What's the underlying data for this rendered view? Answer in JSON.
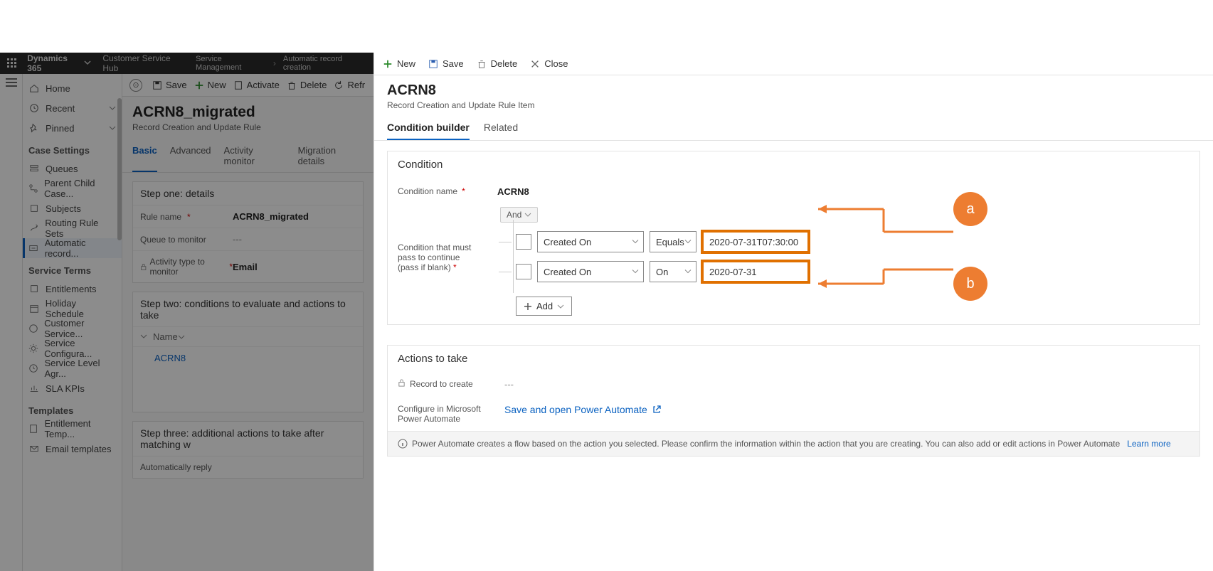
{
  "colors": {
    "accent": "#0b62c1",
    "callout": "#ed7d31"
  },
  "topbar": {
    "brand": "Dynamics 365",
    "hub": "Customer Service Hub",
    "bc1": "Service Management",
    "bc2": "Automatic record creation"
  },
  "nav": {
    "home": "Home",
    "recent": "Recent",
    "pinned": "Pinned",
    "grp_case": "Case Settings",
    "queues": "Queues",
    "parent": "Parent Child Case...",
    "subjects": "Subjects",
    "routing": "Routing Rule Sets",
    "auto": "Automatic record...",
    "grp_terms": "Service Terms",
    "entitle": "Entitlements",
    "holiday": "Holiday Schedule",
    "cust": "Customer Service...",
    "svcconf": "Service Configura...",
    "sla": "Service Level Agr...",
    "slakpi": "SLA KPIs",
    "grp_tpl": "Templates",
    "enttpl": "Entitlement Temp...",
    "emailtpl": "Email templates"
  },
  "cmdbar": {
    "save": "Save",
    "new": "New",
    "activate": "Activate",
    "delete": "Delete",
    "refresh": "Refr"
  },
  "page": {
    "title": "ACRN8_migrated",
    "subtitle": "Record Creation and Update Rule",
    "tabs": {
      "basic": "Basic",
      "advanced": "Advanced",
      "activity": "Activity monitor",
      "migration": "Migration details"
    }
  },
  "step1": {
    "title": "Step one: details",
    "rule_label": "Rule name",
    "rule_value": "ACRN8_migrated",
    "queue_label": "Queue to monitor",
    "queue_value": "---",
    "act_label": "Activity type to monitor",
    "act_value": "Email"
  },
  "step2": {
    "title": "Step two: conditions to evaluate and actions to take",
    "name_col": "Name",
    "row1": "ACRN8"
  },
  "step3": {
    "title": "Step three: additional actions to take after matching w",
    "auto_reply": "Automatically reply"
  },
  "rcmd": {
    "new": "New",
    "save": "Save",
    "delete": "Delete",
    "close": "Close"
  },
  "ritem": {
    "title": "ACRN8",
    "subtitle": "Record Creation and Update Rule Item",
    "tab_cb": "Condition builder",
    "tab_rel": "Related"
  },
  "cond": {
    "section": "Condition",
    "name_label": "Condition name",
    "name_value": "ACRN8",
    "must_label": "Condition that must pass to continue (pass if blank)",
    "and": "And",
    "field": "Created On",
    "op1": "Equals",
    "val1": "2020-07-31T07:30:00",
    "op2": "On",
    "val2": "2020-07-31",
    "add": "Add"
  },
  "actions": {
    "section": "Actions to take",
    "rec_label": "Record to create",
    "rec_value": "---",
    "cfg_label": "Configure in Microsoft Power Automate",
    "pa_link": "Save and open Power Automate",
    "info": "Power Automate creates a flow based on the action you selected. Please confirm the information within the action that you are creating. You can also add or edit actions in Power Automate",
    "learn": "Learn more"
  },
  "callout": {
    "a": "a",
    "b": "b"
  }
}
